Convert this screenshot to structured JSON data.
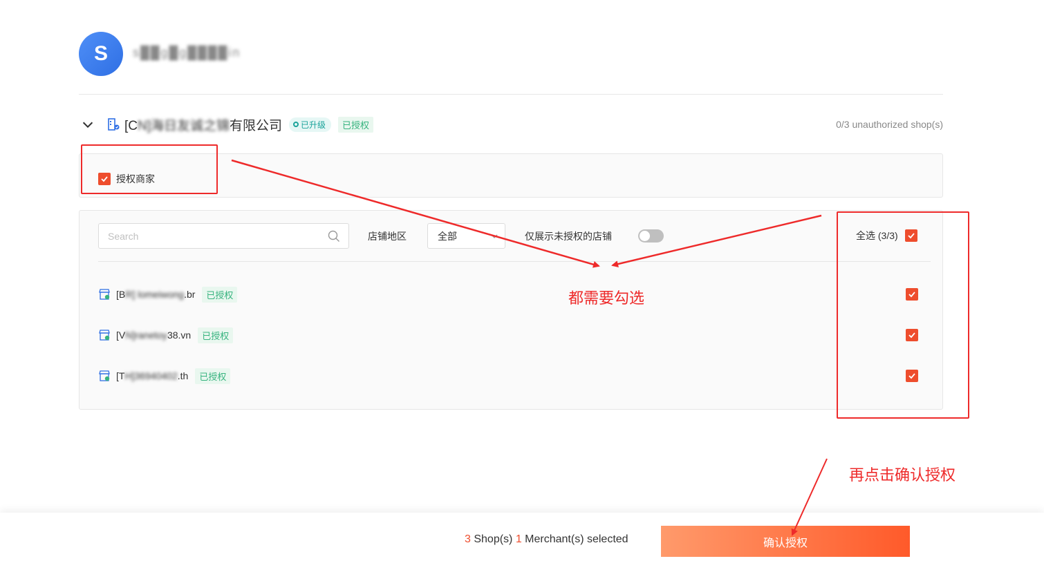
{
  "account": {
    "avatar_letter": "S",
    "name": "s██g█g████in"
  },
  "merchant": {
    "name_prefix": "[C",
    "name_blurred": "N]海日友诚之锦",
    "name_suffix": "有限公司",
    "tag_upgraded": "已升级",
    "tag_authorized": "已授权",
    "unauthorized_count": "0/3 unauthorized shop(s)",
    "authorize_label": "授权商家"
  },
  "filters": {
    "search_placeholder": "Search",
    "region_label": "店铺地区",
    "region_value": "全部",
    "unauth_only_label": "仅展示未授权的店铺",
    "select_all_label": "全选 (3/3)"
  },
  "shops": [
    {
      "prefix": "[B",
      "blurred": "R] lomeiwong",
      "suffix": ".br",
      "tag": "已授权"
    },
    {
      "prefix": "[V",
      "blurred": "N]ranetoy",
      "suffix": "38.vn",
      "tag": "已授权"
    },
    {
      "prefix": "[T",
      "blurred": "H]36940402",
      "suffix": ".th",
      "tag": "已授权"
    }
  ],
  "annotations": {
    "check_all": "都需要勾选",
    "then_confirm": "再点击确认授权"
  },
  "footer": {
    "shop_count": "3",
    "shop_text": " Shop(s) ",
    "merchant_count": "1",
    "merchant_text": " Merchant(s) selected",
    "confirm_label": "确认授权"
  },
  "colors": {
    "accent": "#ee4d2d",
    "annotation_red": "#ee2a2a",
    "authorized_green": "#36b37e"
  }
}
